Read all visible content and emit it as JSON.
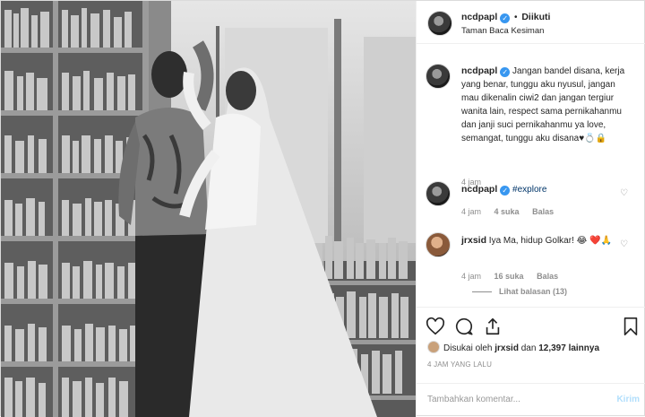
{
  "header": {
    "username": "ncdpapl",
    "separator": "•",
    "follow_status": "Diikuti",
    "location": "Taman Baca Kesiman"
  },
  "caption": {
    "username": "ncdpapl",
    "text": "Jangan bandel disana, kerja yang benar, tunggu aku nyusul, jangan mau dikenalin ciwi2 dan jangan tergiur wanita lain, respect sama pernikahanmu dan janji suci pernikahanmu ya love, semangat, tunggu aku disana♥💍🔒",
    "time": "4 jam"
  },
  "comments": [
    {
      "username": "ncdpapl",
      "text": "#explore",
      "time": "4 jam",
      "likes": "4 suka",
      "reply": "Balas"
    },
    {
      "username": "jrxsid",
      "text": "Iya Ma, hidup Golkar! 😂 ❤️🙏",
      "time": "4 jam",
      "likes": "16 suka",
      "reply": "Balas",
      "view_replies": "Lihat balasan (13)"
    }
  ],
  "actions": {
    "liked_by_prefix": "Disukai oleh",
    "liked_by_user": "jrxsid",
    "liked_by_and": "dan",
    "liked_by_count": "12,397 lainnya",
    "time_ago": "4 JAM YANG LALU"
  },
  "add_comment": {
    "placeholder": "Tambahkan komentar...",
    "send_label": "Kirim"
  },
  "icons": [
    "heart-icon",
    "comment-icon",
    "share-icon",
    "bookmark-icon",
    "verified-icon"
  ],
  "colors": {
    "accent": "#3897f0",
    "muted": "#8e8e8e",
    "send_disabled": "#b2dffc"
  }
}
